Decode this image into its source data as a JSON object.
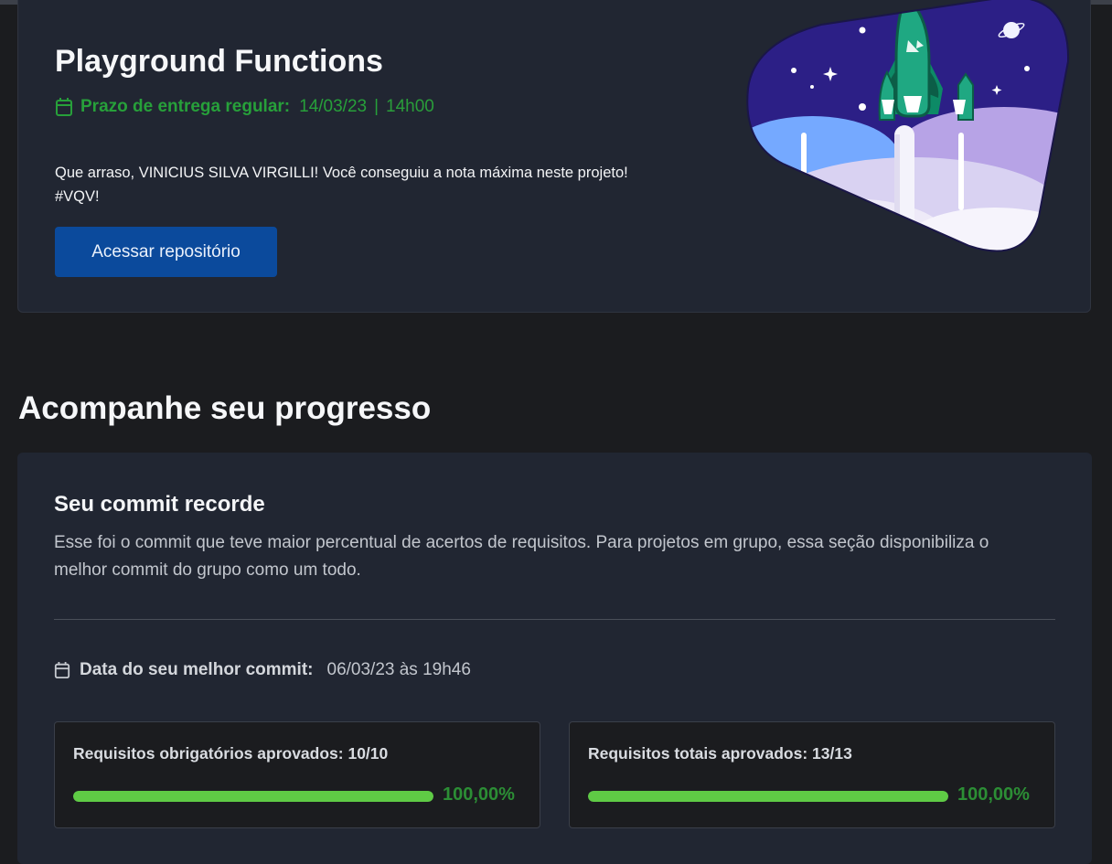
{
  "project": {
    "title": "Playground Functions",
    "deadline_label": "Prazo de entrega regular:",
    "deadline_date": "14/03/23",
    "deadline_separator": "|",
    "deadline_time": "14h00",
    "congrats_line1": "Que arraso, VINICIUS SILVA VIRGILLI! Você conseguiu a nota máxima neste projeto!",
    "congrats_line2": "#VQV!",
    "repo_button": "Acessar repositório"
  },
  "progress": {
    "section_title": "Acompanhe seu progresso",
    "commit_title": "Seu commit recorde",
    "commit_description": "Esse foi o commit que teve maior percentual de acertos de requisitos. Para projetos em grupo, essa seção disponibiliza o melhor commit do grupo como um todo.",
    "best_commit_label": "Data do seu melhor commit:",
    "best_commit_value": "06/03/23 às 19h46",
    "requirements": [
      {
        "label": "Requisitos obrigatórios aprovados: 10/10",
        "percent_text": "100,00%",
        "fraction": 1.0
      },
      {
        "label": "Requisitos totais aprovados: 13/13",
        "percent_text": "100,00%",
        "fraction": 1.0
      }
    ]
  },
  "icons": {
    "deadline": "calendar-icon",
    "best_commit": "calendar-icon",
    "illustration": "rocket-launch-illustration"
  },
  "colors": {
    "success_green": "#27a03a",
    "progress_fill": "#5fcb45",
    "primary_button": "#0b4a9c",
    "card_background": "#212632",
    "page_background": "#1b1c1f"
  }
}
